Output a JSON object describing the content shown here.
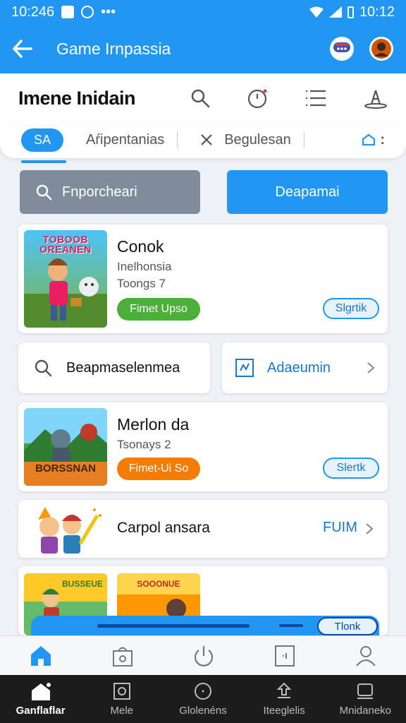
{
  "status_bar": {
    "time_left": "10:246",
    "time_right": "10:12"
  },
  "app_bar": {
    "title": "Game Irnpassia"
  },
  "header": {
    "title": "Imene Inidain"
  },
  "tabs": {
    "active": "SA",
    "tab2": "Aŕipentanias",
    "tab3": "Begulesan"
  },
  "buttons": {
    "left": "Fnporcheari",
    "right": "Deapamai"
  },
  "games": [
    {
      "title": "Conok",
      "sub1": "Inelhonsia",
      "sub2": "Toongs 7",
      "badge": "Fimet Upso",
      "badge_color": "#4caf3a",
      "action": "Slgrtik",
      "thumb_text": "TOBOOB OREANEN"
    },
    {
      "title": "Merlon da",
      "sub1": "Tsonays 2",
      "badge": "Fimet-Ui So",
      "badge_color": "#f57c00",
      "action": "Slertk",
      "thumb_text": "BORSSNAN"
    }
  ],
  "mid_row": {
    "left_label": "Beapmaselenmea",
    "right_label": "Adaeumin"
  },
  "list_item": {
    "label": "Carpol ansara",
    "action": "FUIM"
  },
  "bottom_cards": {
    "thumb1": "BUSSEUE",
    "thumb2": "SOOONUE",
    "pill": "Tlonk"
  },
  "sys_nav": [
    {
      "label": "Ganflaflar",
      "active": true
    },
    {
      "label": "Mele"
    },
    {
      "label": "Glolenéns"
    },
    {
      "label": "Iteeglelis"
    },
    {
      "label": "Mnidaneko"
    }
  ],
  "colors": {
    "primary": "#2196f3",
    "green": "#4caf3a",
    "orange": "#f57c00"
  }
}
